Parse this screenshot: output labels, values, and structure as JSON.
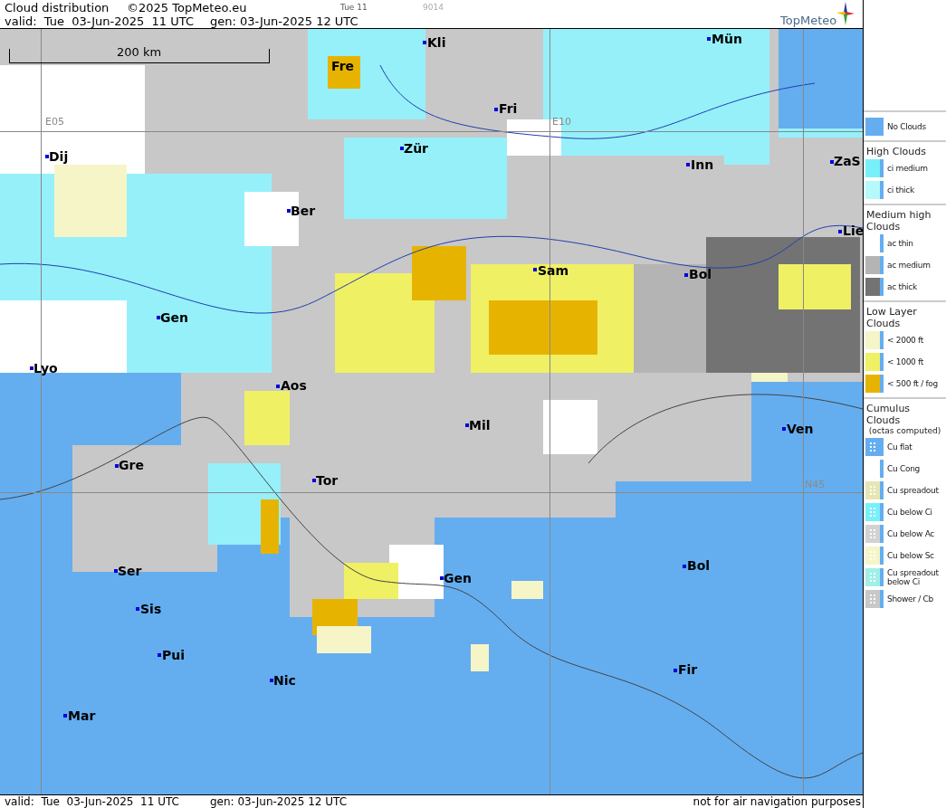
{
  "header": {
    "title": "Cloud distribution",
    "copyright": "©2025 TopMeteo.eu",
    "time_code": "Tue 11",
    "run_code": "9014",
    "valid": "valid:  Tue  03-Jun-2025  11 UTC",
    "generated": "gen: 03-Jun-2025 12 UTC",
    "logo": "TopMeteo"
  },
  "map": {
    "scale": "200 km",
    "grid_labels": [
      "E05",
      "E10",
      "N45"
    ],
    "cities": [
      "Fre",
      "Kli",
      "Mün",
      "Fri",
      "Zür",
      "Dij",
      "Inn",
      "ZaS",
      "Ber",
      "Lie",
      "Sam",
      "Bol",
      "Gen",
      "Lyo",
      "Aos",
      "Mil",
      "Ven",
      "Gre",
      "Tor",
      "Ser",
      "Gen",
      "Bol",
      "Sis",
      "Pui",
      "Nic",
      "Fir",
      "Mar"
    ]
  },
  "legend": [
    {
      "items": [
        {
          "label": "No Clouds",
          "kind": "solid",
          "color": "#64aef0"
        }
      ]
    },
    {
      "heading": "High Clouds",
      "items": [
        {
          "label": "ci medium",
          "kind": "solid",
          "color": "#78f0fa"
        },
        {
          "label": "ci thick",
          "kind": "solid",
          "color": "#b4fafa"
        }
      ]
    },
    {
      "heading": "Medium high Clouds",
      "items": [
        {
          "label": "ac thin",
          "kind": "solid",
          "color": "#ffffff"
        },
        {
          "label": "ac medium",
          "kind": "solid",
          "color": "#b4b4b4"
        },
        {
          "label": "ac thick",
          "kind": "solid",
          "color": "#737373"
        }
      ]
    },
    {
      "heading": "Low Layer Clouds",
      "items": [
        {
          "label": "< 2000 ft",
          "kind": "solid",
          "color": "#f5f5c8"
        },
        {
          "label": "< 1000 ft",
          "kind": "solid",
          "color": "#f0f064"
        },
        {
          "label": "< 500 ft / fog",
          "kind": "solid",
          "color": "#e6b400"
        }
      ]
    },
    {
      "heading": "Cumulus Clouds",
      "note": "(octas computed)",
      "items": [
        {
          "label": "Cu flat",
          "kind": "dotted",
          "color": "#64aef0"
        },
        {
          "label": "Cu Cong",
          "kind": "dotted",
          "color": "#ffffff"
        },
        {
          "label": "Cu spreadout",
          "kind": "dotted",
          "color": "#e6e6b4"
        },
        {
          "label": "Cu below Ci",
          "kind": "dotted",
          "color": "#78f0fa"
        },
        {
          "label": "Cu below Ac",
          "kind": "dotted",
          "color": "#d2d2d2"
        },
        {
          "label": "Cu below Sc",
          "kind": "dotted",
          "color": "#f5f5c8"
        },
        {
          "label": "Cu spreadout below Ci",
          "kind": "dotted",
          "color": "#a0f0e6"
        },
        {
          "label": "Shower / Cb",
          "kind": "dotted",
          "color": "#c8c8c8"
        }
      ]
    }
  ],
  "footer": {
    "valid": "valid:  Tue  03-Jun-2025  11 UTC",
    "generated": "gen: 03-Jun-2025 12 UTC",
    "disclaimer": "not for air navigation purposes"
  }
}
